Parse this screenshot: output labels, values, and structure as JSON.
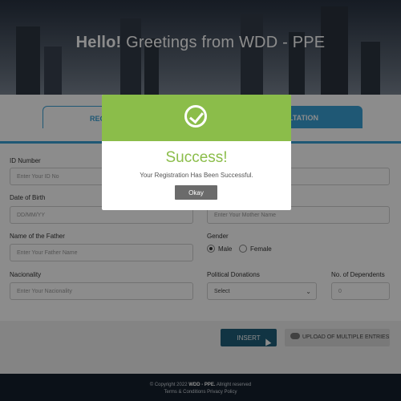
{
  "hero": {
    "title_bold": "Hello!",
    "title_rest": " Greetings from WDD - PPE"
  },
  "tabs": [
    {
      "label": "REG"
    },
    {
      "label": "LTATION"
    }
  ],
  "form": {
    "id_number": {
      "label": "ID Number",
      "placeholder": "Enter Your ID No"
    },
    "dob": {
      "label": "Date of Birth",
      "placeholder": "DD/MM/YY"
    },
    "mother": {
      "placeholder": "Enter Your Mother Name"
    },
    "father": {
      "label": "Name of the Father",
      "placeholder": "Enter Your Father Name"
    },
    "gender": {
      "label": "Gender",
      "options": [
        "Male",
        "Female"
      ],
      "selected": "Male"
    },
    "nationality": {
      "label": "Nacionality",
      "placeholder": "Enter Your Nacionality"
    },
    "political": {
      "label": "Political Donations",
      "value": "Select"
    },
    "dependents": {
      "label": "No. of Dependents",
      "placeholder": "0"
    }
  },
  "actions": {
    "insert": "INSERT",
    "upload": "UPLOAD OF MULTIPLE ENTRIES"
  },
  "footer": {
    "copyright_prefix": "© Copyright 2022 ",
    "copyright_brand": "WDD - PPE.",
    "copyright_suffix": " Allright reserved",
    "links": "Terms & Conditions Privacy Policy"
  },
  "modal": {
    "title": "Success!",
    "message": "Your Registration Has Been Successful.",
    "okay": "Okay"
  },
  "colors": {
    "accent": "#3aa1d6",
    "success": "#8bbd4a",
    "insert": "#1f5f7a",
    "footer": "#15202d"
  }
}
